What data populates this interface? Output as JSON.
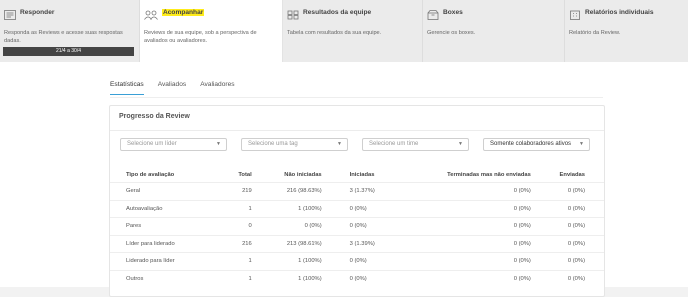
{
  "cards": [
    {
      "title": "Responder",
      "icon": "list-icon",
      "desc": "Responda as Reviews e acesse suas respostas dadas.",
      "progress": "21/4 a 30/4"
    },
    {
      "title": "Acompanhar",
      "icon": "people-icon",
      "desc": "Reviews de sua equipe, sob a perspectiva de avaliados ou avaliadores."
    },
    {
      "title": "Resultados da equipe",
      "icon": "grid-icon",
      "desc": "Tabela com resultados da sua equipe."
    },
    {
      "title": "Boxes",
      "icon": "box-icon",
      "desc": "Gerencie os boxes."
    },
    {
      "title": "Relatórios individuais",
      "icon": "building-icon",
      "desc": "Relatório da Review."
    }
  ],
  "tabs": [
    "Estatísticas",
    "Avaliados",
    "Avaliadores"
  ],
  "panel": {
    "title": "Progresso da Review"
  },
  "filters": {
    "leader": "Selecione um líder",
    "tag": "Selecione uma tag",
    "time": "Selecione um time",
    "status": "Somente colaboradores ativos"
  },
  "table": {
    "headers": [
      "Tipo de avaliação",
      "Total",
      "Não iniciadas",
      "Iniciadas",
      "Terminadas mas não enviadas",
      "Enviadas"
    ],
    "rows": [
      [
        "Geral",
        "219",
        "216 (98.63%)",
        "3 (1.37%)",
        "0 (0%)",
        "0 (0%)"
      ],
      [
        "Autoavaliação",
        "1",
        "1 (100%)",
        "0 (0%)",
        "0 (0%)",
        "0 (0%)"
      ],
      [
        "Pares",
        "0",
        "0 (0%)",
        "0 (0%)",
        "0 (0%)",
        "0 (0%)"
      ],
      [
        "Líder para liderado",
        "216",
        "213 (98.61%)",
        "3 (1.39%)",
        "0 (0%)",
        "0 (0%)"
      ],
      [
        "Liderado para líder",
        "1",
        "1 (100%)",
        "0 (0%)",
        "0 (0%)",
        "0 (0%)"
      ],
      [
        "Outros",
        "1",
        "1 (100%)",
        "0 (0%)",
        "0 (0%)",
        "0 (0%)"
      ]
    ]
  },
  "colors": {
    "accent": "#3a9fd6",
    "highlight": "#ffec1a",
    "progress": "#444444"
  }
}
